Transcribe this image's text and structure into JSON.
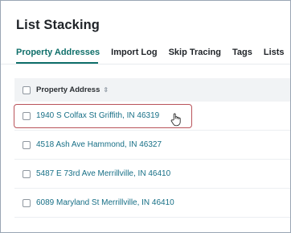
{
  "page": {
    "title": "List Stacking"
  },
  "tabs": [
    {
      "label": "Property Addresses",
      "active": true
    },
    {
      "label": "Import Log",
      "active": false
    },
    {
      "label": "Skip Tracing",
      "active": false
    },
    {
      "label": "Tags",
      "active": false
    },
    {
      "label": "Lists",
      "active": false
    }
  ],
  "table": {
    "header": {
      "address_label": "Property Address",
      "sort_icon": "sort-icon"
    },
    "rows": [
      {
        "address": "1940 S Colfax St Griffith, IN 46319",
        "highlighted": true
      },
      {
        "address": "4518 Ash Ave Hammond, IN 46327",
        "highlighted": false
      },
      {
        "address": "5487 E 73rd Ave Merrillville, IN 46410",
        "highlighted": false
      },
      {
        "address": "6089 Maryland St Merrillville, IN 46410",
        "highlighted": false
      }
    ]
  },
  "colors": {
    "accent": "#0f6f6a",
    "link": "#176f86",
    "highlight": "#b9535a"
  },
  "cursor": "hand-pointer-icon"
}
